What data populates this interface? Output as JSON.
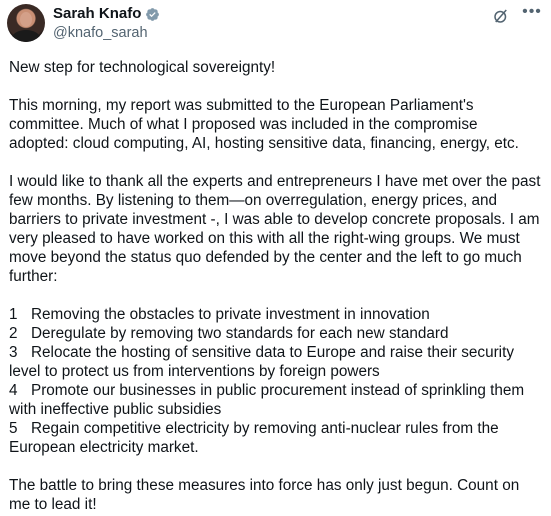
{
  "author": {
    "display_name": "Sarah Knafo",
    "handle": "@knafo_sarah"
  },
  "icons": {
    "verified": "verified-badge-icon",
    "grok": "grok-icon",
    "more": "more-options-icon"
  },
  "colors": {
    "text": "#0f1419",
    "secondary": "#536471",
    "verified_badge": "#829aab"
  },
  "post": {
    "intro": "New step for technological sovereignty!",
    "para1": "This morning, my report was submitted to the European Parliament's committee. Much of what I proposed was included in the compromise adopted: cloud computing, AI, hosting sensitive data, financing, energy, etc.",
    "para2": "I would like to thank all the experts and entrepreneurs I have met over the past few months. By listening to them—on overregulation, energy prices, and barriers to private investment -, I was able to develop concrete proposals. I am very pleased to have worked on this with all the right-wing groups. We must move beyond the status quo defended by the center and the left to go much further:",
    "list": [
      {
        "num": "1",
        "text": "Removing the obstacles to private investment in innovation"
      },
      {
        "num": "2",
        "text": "Deregulate by removing two standards for each new standard"
      },
      {
        "num": "3",
        "text": "Relocate the hosting of sensitive data to Europe and raise their security level to protect us from interventions by foreign powers"
      },
      {
        "num": "4",
        "text": "Promote our businesses in public procurement instead of sprinkling them with ineffective public subsidies"
      },
      {
        "num": "5",
        "text": "Regain competitive electricity by removing anti-nuclear rules from the European electricity market."
      }
    ],
    "closing": "The battle to bring these measures into force has only just begun. Count on me to lead it!"
  }
}
